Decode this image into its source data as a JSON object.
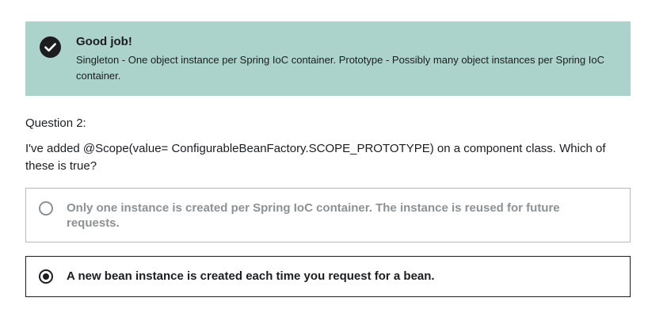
{
  "feedback": {
    "title": "Good job!",
    "message": "Singleton - One object instance per Spring IoC container. Prototype - Possibly many object instances per Spring IoC container.",
    "icon": "check-circle-icon",
    "background_color": "#acd2cc"
  },
  "question": {
    "label": "Question 2:",
    "text": "I've added @Scope(value= ConfigurableBeanFactory.SCOPE_PROTOTYPE) on a component class. Which of these is true?"
  },
  "options": [
    {
      "label": "Only one instance is created per Spring IoC container. The instance is reused for future requests.",
      "selected": false
    },
    {
      "label": "A new bean instance is created each time you request for a bean.",
      "selected": true
    }
  ]
}
